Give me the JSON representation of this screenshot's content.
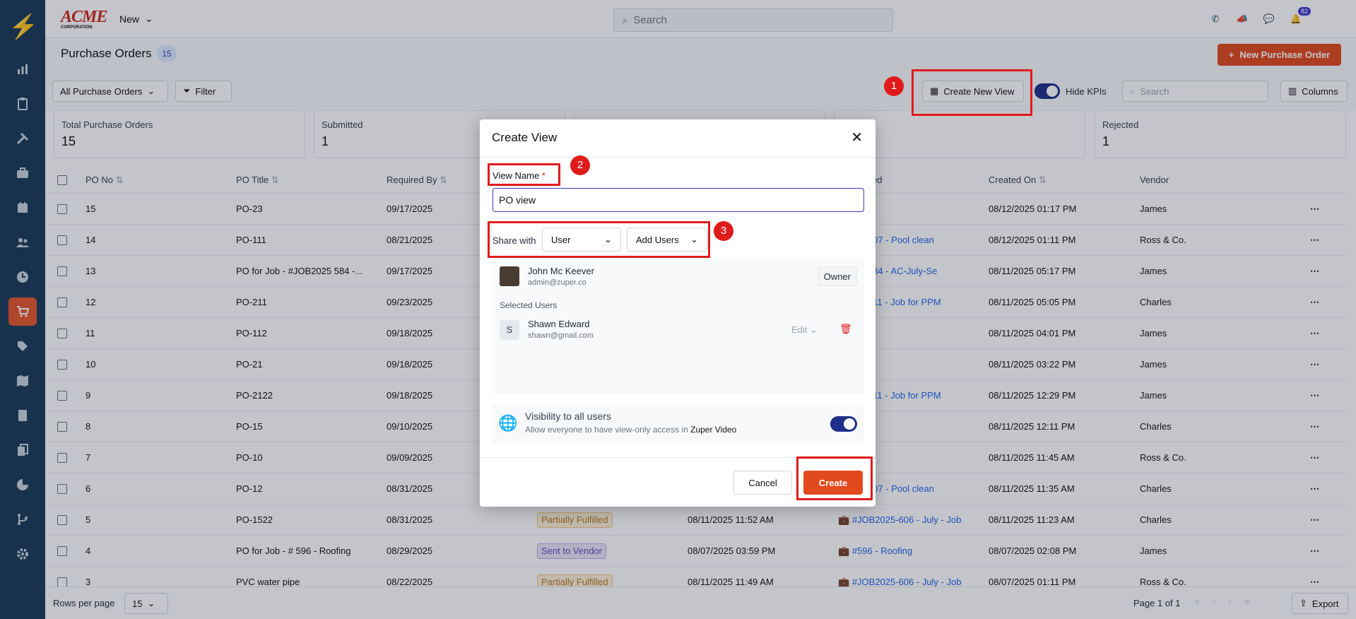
{
  "brand": {
    "logo_text": "ACME",
    "logo_sub": "CORPORATION"
  },
  "topbar": {
    "new_label": "New",
    "search_placeholder": "Search",
    "notification_count": "82"
  },
  "page": {
    "title": "Purchase Orders",
    "count": "15",
    "new_button": "New Purchase Order"
  },
  "toolbar": {
    "view_select": "All Purchase Orders",
    "filter": "Filter",
    "create_view": "Create New View",
    "hide_kpis": "Hide KPIs",
    "search_placeholder": "Search",
    "columns": "Columns"
  },
  "kpis": [
    {
      "label": "Total Purchase Orders",
      "value": "15"
    },
    {
      "label": "Submitted",
      "value": "1"
    },
    {
      "label": "Rejected",
      "value": "1"
    }
  ],
  "table": {
    "headers": {
      "po_no": "PO No",
      "po_title": "PO Title",
      "required_by": "Required By",
      "related": "ed",
      "created_on": "Created On",
      "vendor": "Vendor"
    },
    "rows": [
      {
        "no": "15",
        "title": "PO-23",
        "req": "09/17/2025",
        "status": "",
        "status_color": "",
        "created": "",
        "related": "",
        "created_on": "08/12/2025 01:17 PM",
        "vendor": "James"
      },
      {
        "no": "14",
        "title": "PO-111",
        "req": "08/21/2025",
        "status": "",
        "status_color": "",
        "created": "",
        "related": "B2025-607 - Pool clean",
        "created_on": "08/12/2025 01:11 PM",
        "vendor": "Ross & Co."
      },
      {
        "no": "13",
        "title": "PO for Job - #JOB2025 584 -...",
        "req": "09/17/2025",
        "status": "",
        "status_color": "",
        "created": "",
        "related": "B2025-584 - AC-July-Se",
        "created_on": "08/11/2025 05:17 PM",
        "vendor": "James"
      },
      {
        "no": "12",
        "title": "PO-211",
        "req": "09/23/2025",
        "status": "",
        "status_color": "",
        "created": "",
        "related": "B2025-611 - Job for PPM",
        "created_on": "08/11/2025 05:05 PM",
        "vendor": "Charles"
      },
      {
        "no": "11",
        "title": "PO-112",
        "req": "09/18/2025",
        "status": "",
        "status_color": "",
        "created": "",
        "related": "",
        "created_on": "08/11/2025 04:01 PM",
        "vendor": "James"
      },
      {
        "no": "10",
        "title": "PO-21",
        "req": "09/18/2025",
        "status": "",
        "status_color": "",
        "created": "",
        "related": "",
        "created_on": "08/11/2025 03:22 PM",
        "vendor": "James"
      },
      {
        "no": "9",
        "title": "PO-2122",
        "req": "09/18/2025",
        "status": "",
        "status_color": "",
        "created": "",
        "related": "B2025-611 - Job for PPM",
        "created_on": "08/11/2025 12:29 PM",
        "vendor": "James"
      },
      {
        "no": "8",
        "title": "PO-15",
        "req": "09/10/2025",
        "status": "",
        "status_color": "",
        "created": "",
        "related": "",
        "created_on": "08/11/2025 12:11 PM",
        "vendor": "Charles"
      },
      {
        "no": "7",
        "title": "PO-10",
        "req": "09/09/2025",
        "status": "",
        "status_color": "",
        "created": "",
        "related": "",
        "created_on": "08/11/2025 11:45 AM",
        "vendor": "Ross & Co."
      },
      {
        "no": "6",
        "title": "PO-12",
        "req": "08/31/2025",
        "status": "",
        "status_color": "",
        "created": "",
        "related": "B2025-607 - Pool clean",
        "created_on": "08/11/2025 11:35 AM",
        "vendor": "Charles"
      },
      {
        "no": "5",
        "title": "PO-1522",
        "req": "08/31/2025",
        "status": "Partially Fulfilled",
        "status_color": "#fdf1d8",
        "created": "08/11/2025 11:52 AM",
        "related": "#JOB2025-606 - July - Job",
        "created_on": "08/11/2025 11:23 AM",
        "vendor": "Charles"
      },
      {
        "no": "4",
        "title": "PO for Job - # 596 - Roofing",
        "req": "08/29/2025",
        "status": "Sent to Vendor",
        "status_color": "#ede4f7",
        "created": "08/07/2025 03:59 PM",
        "related": "#596 - Roofing",
        "created_on": "08/07/2025 02:08 PM",
        "vendor": "James"
      },
      {
        "no": "3",
        "title": "PVC water pipe",
        "req": "08/22/2025",
        "status": "Partially Fulfilled",
        "status_color": "#fdf1d8",
        "created": "08/11/2025 11:49 AM",
        "related": "#JOB2025-606 - July - Job",
        "created_on": "08/07/2025 01:11 PM",
        "vendor": "Ross & Co."
      }
    ]
  },
  "footer": {
    "rows_per_page_label": "Rows per page",
    "rows_per_page": "15",
    "page_info": "Page 1 of 1",
    "export": "Export"
  },
  "modal": {
    "title": "Create View",
    "view_name_label": "View Name",
    "required_mark": "*",
    "view_name_value": "PO view",
    "share_with_label": "Share with",
    "share_type": "User",
    "add_users": "Add Users",
    "owner": {
      "name": "John Mc Keever",
      "email": "admin@zuper.co",
      "role": "Owner"
    },
    "selected_users_label": "Selected Users",
    "selected_user": {
      "initial": "S",
      "name": "Shawn Edward",
      "email": "shawn@gmail.com",
      "permission": "Edit"
    },
    "visibility_title": "Visibility to all users",
    "visibility_desc": "Allow everyone to have view-only access in",
    "visibility_app": "Zuper Video",
    "cancel": "Cancel",
    "create": "Create"
  },
  "callouts": {
    "one": "1",
    "two": "2",
    "three": "3"
  },
  "colors": {
    "brand_orange": "#e24a1e",
    "sidebar": "#1b3b58",
    "accent": "#1e2f8a",
    "annotation_red": "#e01b1b"
  }
}
